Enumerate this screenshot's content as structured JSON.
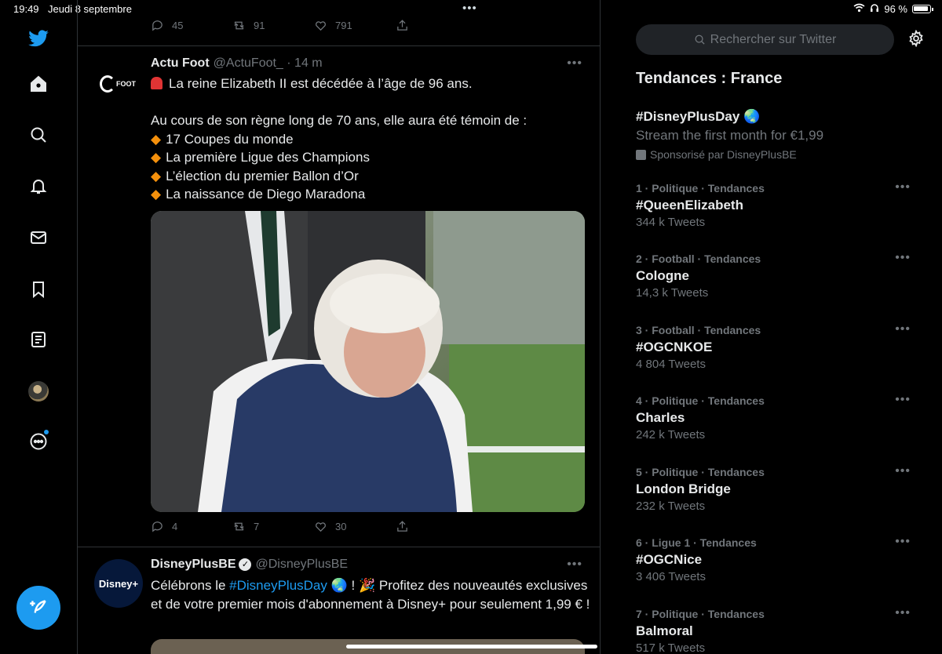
{
  "status_bar": {
    "time": "19:49",
    "date": "Jeudi 8 septembre",
    "dots": "•••",
    "battery": "96 %"
  },
  "nav": {
    "icons": [
      "twitter-logo-icon",
      "home-icon",
      "search-icon",
      "bell-icon",
      "mail-icon",
      "bookmark-icon",
      "lists-icon",
      "avatar",
      "more-circle-icon",
      "compose-tweet-icon"
    ]
  },
  "prev_tweet": {
    "replies": "45",
    "retweets": "91",
    "likes": "791"
  },
  "tweet1": {
    "name": "Actu Foot",
    "handle": "@ActuFoot_ · 14 m",
    "more": "•••",
    "logo": "FOOT",
    "line1": "La reine Elizabeth II est décédée à l’âge de 96 ans.",
    "line2": "Au cours de son règne long de 70 ans, elle aura été témoin de :",
    "bullets": [
      "17 Coupes du monde",
      "La première Ligue des Champions",
      "L’élection du premier Ballon d’Or",
      "La naissance de Diego Maradona"
    ],
    "replies": "4",
    "retweets": "7",
    "likes": "30"
  },
  "tweet2": {
    "name": "DisneyPlusBE",
    "handle": "@DisneyPlusBE",
    "more": "•••",
    "avatar_label": "Disney+",
    "text_pre": "Célébrons le ",
    "hashtag": "#DisneyPlusDay",
    "text_post": " ! 🎉 Profitez des nouveautés exclusives et de votre premier mois d'abonnement à Disney+ pour seulement 1,99 € !"
  },
  "search": {
    "placeholder": "Rechercher sur Twitter"
  },
  "trends": {
    "title": "Tendances : France",
    "promoted": {
      "name": "#DisneyPlusDay 🌏",
      "desc": "Stream the first month for €1,99",
      "by": "Sponsorisé par DisneyPlusBE"
    },
    "items": [
      {
        "meta": "1 · Politique · Tendances",
        "name": "#QueenElizabeth",
        "count": "344 k Tweets"
      },
      {
        "meta": "2 · Football · Tendances",
        "name": "Cologne",
        "count": "14,3 k Tweets"
      },
      {
        "meta": "3 · Football · Tendances",
        "name": "#OGCNKOE",
        "count": "4 804 Tweets"
      },
      {
        "meta": "4 · Politique · Tendances",
        "name": "Charles",
        "count": "242 k Tweets"
      },
      {
        "meta": "5 · Politique · Tendances",
        "name": "London Bridge",
        "count": "232 k Tweets"
      },
      {
        "meta": "6 · Ligue 1 · Tendances",
        "name": "#OGCNice",
        "count": "3 406 Tweets"
      },
      {
        "meta": "7 · Politique · Tendances",
        "name": "Balmoral",
        "count": "517 k Tweets"
      }
    ],
    "more": "•••"
  },
  "colors": {
    "accent": "#1d9bf0",
    "background": "#000000",
    "muted": "#71767b",
    "border": "#2f3336"
  }
}
